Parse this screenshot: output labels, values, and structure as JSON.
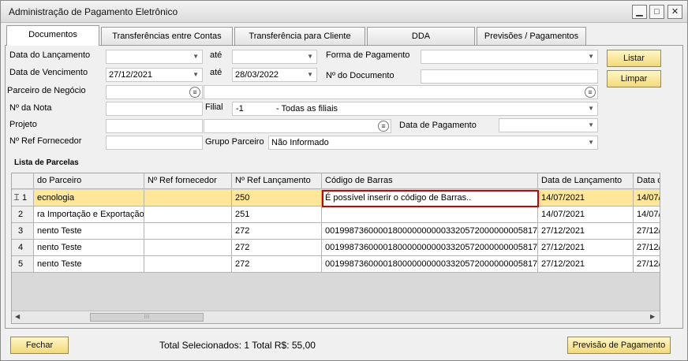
{
  "window": {
    "title": "Administração de Pagamento Eletrônico",
    "min_label": "▁",
    "max_label": "□",
    "close_label": "✕"
  },
  "tabs": [
    "Documentos",
    "Transferências entre Contas",
    "Transferência para Cliente",
    "DDA",
    "Previsões / Pagamentos"
  ],
  "form": {
    "data_lancamento_label": "Data do Lançamento",
    "ate_label": "até",
    "forma_pagamento_label": "Forma de Pagamento",
    "data_vencimento_label": "Data de Vencimento",
    "data_vencimento_from": "27/12/2021",
    "data_vencimento_to": "28/03/2022",
    "num_documento_label": "Nº do Documento",
    "parceiro_label": "Parceiro de Negócio",
    "nota_label": "Nº da Nota",
    "filial_label": "Filial",
    "filial_code": "-1",
    "filial_value": "- Todas as filiais",
    "projeto_label": "Projeto",
    "data_pagamento_label": "Data de Pagamento",
    "ref_fornecedor_label": "Nº Ref Fornecedor",
    "grupo_parceiro_label": "Grupo Parceiro",
    "grupo_parceiro_value": "Não Informado"
  },
  "buttons": {
    "listar": "Listar",
    "limpar": "Limpar",
    "fechar": "Fechar",
    "previsao": "Previsão de Pagamento"
  },
  "table": {
    "section_title": "Lista de Parcelas",
    "headers": [
      "do Parceiro",
      "Nº Ref fornecedor",
      "Nº Ref Lançamento",
      "Código de Barras",
      "Data de Lançamento",
      "Data d"
    ],
    "rows": [
      {
        "num": "1",
        "parceiro": "ecnologia",
        "ref_forn": "",
        "ref_lanc": "250",
        "codigo": "É possível inserir o código de Barras..",
        "data_lanc": "14/07/2021",
        "data_d": "14/07/"
      },
      {
        "num": "2",
        "parceiro": "ra Importação e Exportação",
        "ref_forn": "",
        "ref_lanc": "251",
        "codigo": "",
        "data_lanc": "14/07/2021",
        "data_d": "14/07/"
      },
      {
        "num": "3",
        "parceiro": "nento Teste",
        "ref_forn": "",
        "ref_lanc": "272",
        "codigo": "00199873600001800000000003320572000000005817",
        "data_lanc": "27/12/2021",
        "data_d": "27/12/"
      },
      {
        "num": "4",
        "parceiro": "nento Teste",
        "ref_forn": "",
        "ref_lanc": "272",
        "codigo": "00199873600001800000000003320572000000005817",
        "data_lanc": "27/12/2021",
        "data_d": "27/12/"
      },
      {
        "num": "5",
        "parceiro": "nento Teste",
        "ref_forn": "",
        "ref_lanc": "272",
        "codigo": "00199873600001800000000003320572000000005817",
        "data_lanc": "27/12/2021",
        "data_d": "27/12/"
      }
    ]
  },
  "footer": {
    "total_text": "Total Selecionados: 1 Total R$: 55,00"
  }
}
